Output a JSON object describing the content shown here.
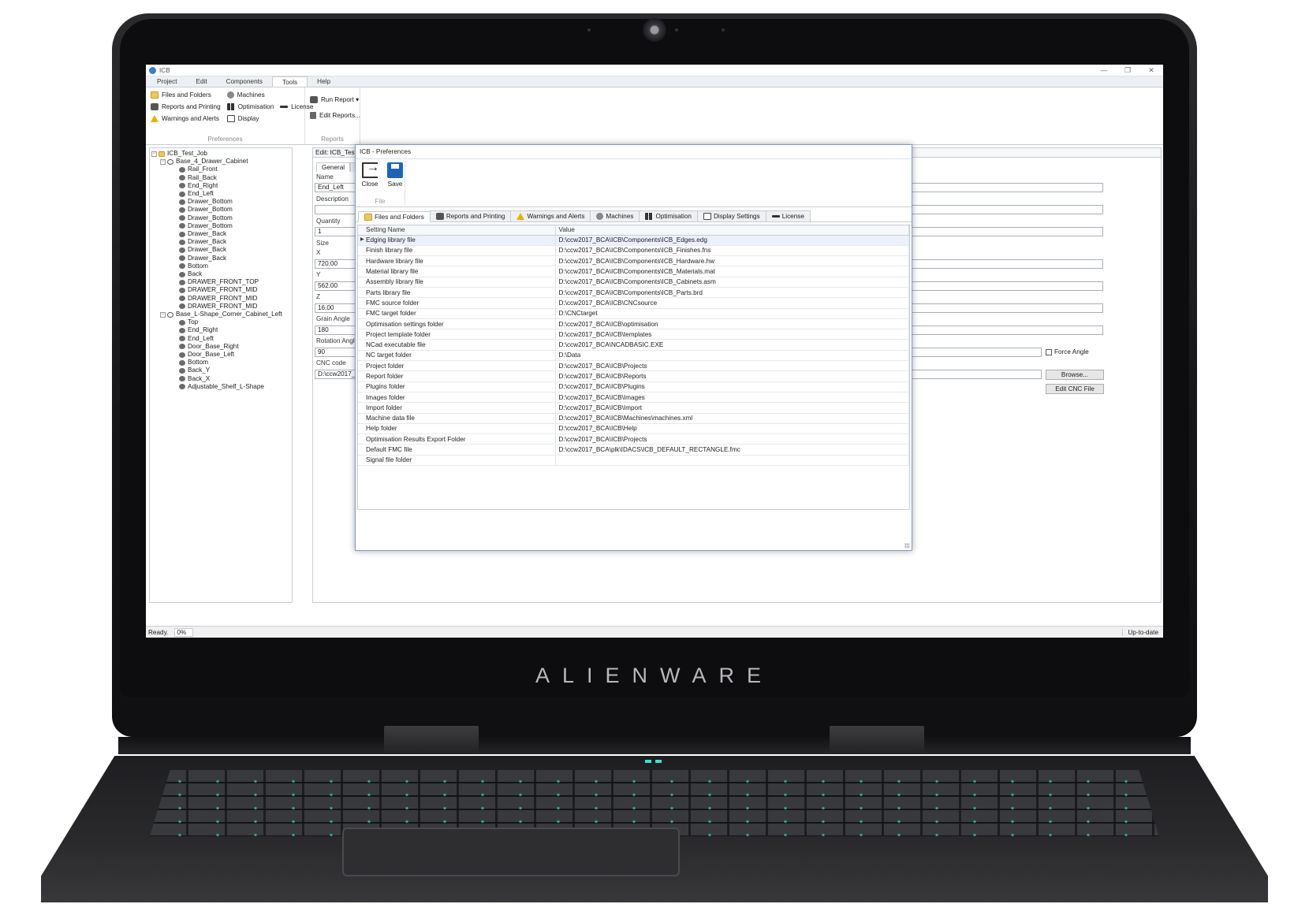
{
  "brand": "ALIENWARE",
  "window": {
    "title": "ICB",
    "min": "—",
    "max": "❐",
    "close": "✕"
  },
  "menu_tabs": [
    "Project",
    "Edit",
    "Components",
    "Tools",
    "Help"
  ],
  "active_menu_tab": "Tools",
  "ribbon": {
    "preferences": {
      "label": "Preferences",
      "col1": [
        "Files and Folders",
        "Reports and Printing",
        "Warnings and Alerts"
      ],
      "col2": [
        "Machines",
        "Optimisation",
        "Display"
      ],
      "col3": [
        "License"
      ]
    },
    "reports": {
      "label": "Reports",
      "run": "Run Report ▾",
      "edit": "Edit Reports..."
    }
  },
  "tree": [
    {
      "label": "ICB_Test_Job",
      "level": 0,
      "kind": "job",
      "exp": "−"
    },
    {
      "label": "Base_4_Drawer_Cabinet",
      "level": 1,
      "kind": "asm",
      "exp": "−"
    },
    {
      "label": "Rail_Front",
      "level": 2,
      "kind": "part"
    },
    {
      "label": "Rail_Back",
      "level": 2,
      "kind": "part"
    },
    {
      "label": "End_Right",
      "level": 2,
      "kind": "part"
    },
    {
      "label": "End_Left",
      "level": 2,
      "kind": "part"
    },
    {
      "label": "Drawer_Bottom",
      "level": 2,
      "kind": "part"
    },
    {
      "label": "Drawer_Bottom",
      "level": 2,
      "kind": "part"
    },
    {
      "label": "Drawer_Bottom",
      "level": 2,
      "kind": "part"
    },
    {
      "label": "Drawer_Bottom",
      "level": 2,
      "kind": "part"
    },
    {
      "label": "Drawer_Back",
      "level": 2,
      "kind": "part"
    },
    {
      "label": "Drawer_Back",
      "level": 2,
      "kind": "part"
    },
    {
      "label": "Drawer_Back",
      "level": 2,
      "kind": "part"
    },
    {
      "label": "Drawer_Back",
      "level": 2,
      "kind": "part"
    },
    {
      "label": "Bottom",
      "level": 2,
      "kind": "part"
    },
    {
      "label": "Back",
      "level": 2,
      "kind": "part"
    },
    {
      "label": "DRAWER_FRONT_TOP",
      "level": 2,
      "kind": "part"
    },
    {
      "label": "DRAWER_FRONT_MID",
      "level": 2,
      "kind": "part"
    },
    {
      "label": "DRAWER_FRONT_MID",
      "level": 2,
      "kind": "part"
    },
    {
      "label": "DRAWER_FRONT_MID",
      "level": 2,
      "kind": "part"
    },
    {
      "label": "Base_L-Shape_Corner_Cabinet_Left",
      "level": 1,
      "kind": "asm",
      "exp": "−"
    },
    {
      "label": "Top",
      "level": 2,
      "kind": "part"
    },
    {
      "label": "End_Right",
      "level": 2,
      "kind": "part"
    },
    {
      "label": "End_Left",
      "level": 2,
      "kind": "part"
    },
    {
      "label": "Door_Base_Right",
      "level": 2,
      "kind": "part"
    },
    {
      "label": "Door_Base_Left",
      "level": 2,
      "kind": "part"
    },
    {
      "label": "Bottom",
      "level": 2,
      "kind": "part"
    },
    {
      "label": "Back_Y",
      "level": 2,
      "kind": "part"
    },
    {
      "label": "Back_X",
      "level": 2,
      "kind": "part"
    },
    {
      "label": "Adjustable_Shelf_L-Shape",
      "level": 2,
      "kind": "part"
    }
  ],
  "editor": {
    "header": "Edit: ICB_Test_J",
    "tabs": [
      "General",
      "Ha"
    ],
    "labels": {
      "name": "Name",
      "description": "Description",
      "quantity": "Quantity",
      "size": "Size",
      "x": "X",
      "y": "Y",
      "z": "Z",
      "grain": "Grain Angle",
      "rotation": "Rotation Angle",
      "cnc": "CNC code"
    },
    "values": {
      "name": "End_Left",
      "description": "",
      "quantity": "1",
      "x": "720.00",
      "y": "562.00",
      "z": "16.00",
      "grain": "180",
      "rotation": "90",
      "cnc": "D:\\ccw2017_B"
    },
    "force_angle": "Force Angle",
    "browse": "Browse...",
    "edit_cnc": "Edit CNC File"
  },
  "status": {
    "text": "Ready.",
    "progress": "0%",
    "right": "Up-to-date"
  },
  "dialog": {
    "title": "ICB - Preferences",
    "close": "Close",
    "save": "Save",
    "group": "File",
    "tabs": [
      "Files and Folders",
      "Reports and Printing",
      "Warnings and Alerts",
      "Machines",
      "Optimisation",
      "Display Settings",
      "License"
    ],
    "active_tab": "Files and Folders",
    "columns": [
      "Setting Name",
      "Value"
    ],
    "rows": [
      [
        "Edging library file",
        "D:\\ccw2017_BCA\\ICB\\Components\\ICB_Edges.edg"
      ],
      [
        "Finish library file",
        "D:\\ccw2017_BCA\\ICB\\Components\\ICB_Finishes.fns"
      ],
      [
        "Hardware library file",
        "D:\\ccw2017_BCA\\ICB\\Components\\ICB_Hardware.hw"
      ],
      [
        "Material library file",
        "D:\\ccw2017_BCA\\ICB\\Components\\ICB_Materials.mat"
      ],
      [
        "Assembly library file",
        "D:\\ccw2017_BCA\\ICB\\Components\\ICB_Cabinets.asm"
      ],
      [
        "Parts library file",
        "D:\\ccw2017_BCA\\ICB\\Components\\ICB_Parts.brd"
      ],
      [
        "FMC source folder",
        "D:\\ccw2017_BCA\\ICB\\CNCsource"
      ],
      [
        "FMC target folder",
        "D:\\CNCtarget"
      ],
      [
        "Optimisation settings folder",
        "D:\\ccw2017_BCA\\ICB\\optimisation"
      ],
      [
        "Project template folder",
        "D:\\ccw2017_BCA\\ICB\\templates"
      ],
      [
        "NCad executable file",
        "D:\\ccw2017_BCA\\NCADBASIC.EXE"
      ],
      [
        "NC target folder",
        "D:\\Data"
      ],
      [
        "Project folder",
        "D:\\ccw2017_BCA\\ICB\\Projects"
      ],
      [
        "Report folder",
        "D:\\ccw2017_BCA\\ICB\\Reports"
      ],
      [
        "Plugins folder",
        "D:\\ccw2017_BCA\\ICB\\Plugins"
      ],
      [
        "Images folder",
        "D:\\ccw2017_BCA\\ICB\\Images"
      ],
      [
        "Import folder",
        "D:\\ccw2017_BCA\\ICB\\Import"
      ],
      [
        "Machine data file",
        "D:\\ccw2017_BCA\\ICB\\Machines\\machines.xml"
      ],
      [
        "Help folder",
        "D:\\ccw2017_BCA\\ICB\\Help"
      ],
      [
        "Optimisation Results Export Folder",
        "D:\\ccw2017_BCA\\ICB\\Projects"
      ],
      [
        "Default FMC file",
        "D:\\ccw2017_BCA\\plk\\IDACS\\ICB_DEFAULT_RECTANGLE.fmc"
      ],
      [
        "Signal file folder",
        ""
      ]
    ]
  }
}
